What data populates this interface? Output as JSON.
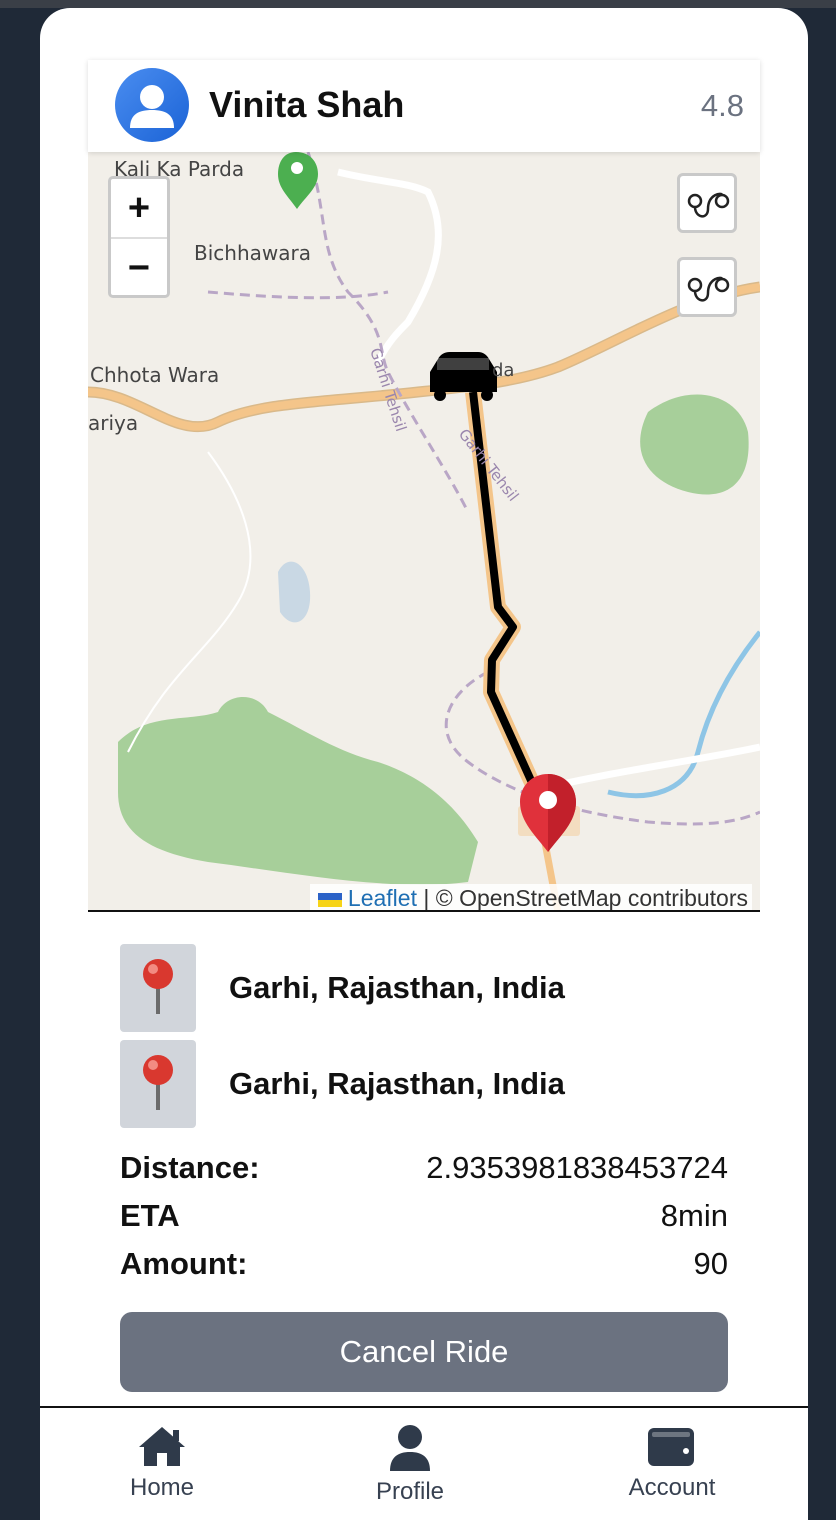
{
  "driver": {
    "name": "Vinita Shah",
    "rating": "4.8",
    "avatar_icon": "user-avatar-icon"
  },
  "map": {
    "place_labels": [
      "Kali Ka Parda",
      "Bichhawara",
      "Chhota Wara",
      "ariya",
      "Garhi Tehsil",
      "Garhi Tehsil",
      "da"
    ],
    "zoom_in_label": "+",
    "zoom_out_label": "−",
    "attribution": {
      "link": "Leaflet",
      "separator": " | ",
      "text": "© OpenStreetMap contributors"
    },
    "icons": [
      "car-icon",
      "destination-marker-icon",
      "start-marker-icon",
      "route-icon"
    ],
    "colors": {
      "route": "#000000",
      "destination_marker": "#e0313b",
      "start_marker": "#4caf50",
      "road_major": "#f4c58a",
      "forest": "#a7cf9a",
      "water": "#8ec5e6"
    }
  },
  "locations": [
    {
      "text": "Garhi, Rajasthan, India",
      "icon": "pushpin-icon"
    },
    {
      "text": "Garhi, Rajasthan, India",
      "icon": "pushpin-icon"
    }
  ],
  "details": [
    {
      "label": "Distance:",
      "value": "2.9353981838453724"
    },
    {
      "label": "ETA",
      "value": "8min"
    },
    {
      "label": "Amount:",
      "value": "90"
    }
  ],
  "cancel_button": "Cancel Ride",
  "nav": {
    "home": "Home",
    "profile": "Profile",
    "account": "Account"
  },
  "colors": {
    "page_bg": "#1f2937",
    "button": "#6b7280",
    "nav_text": "#374151"
  }
}
